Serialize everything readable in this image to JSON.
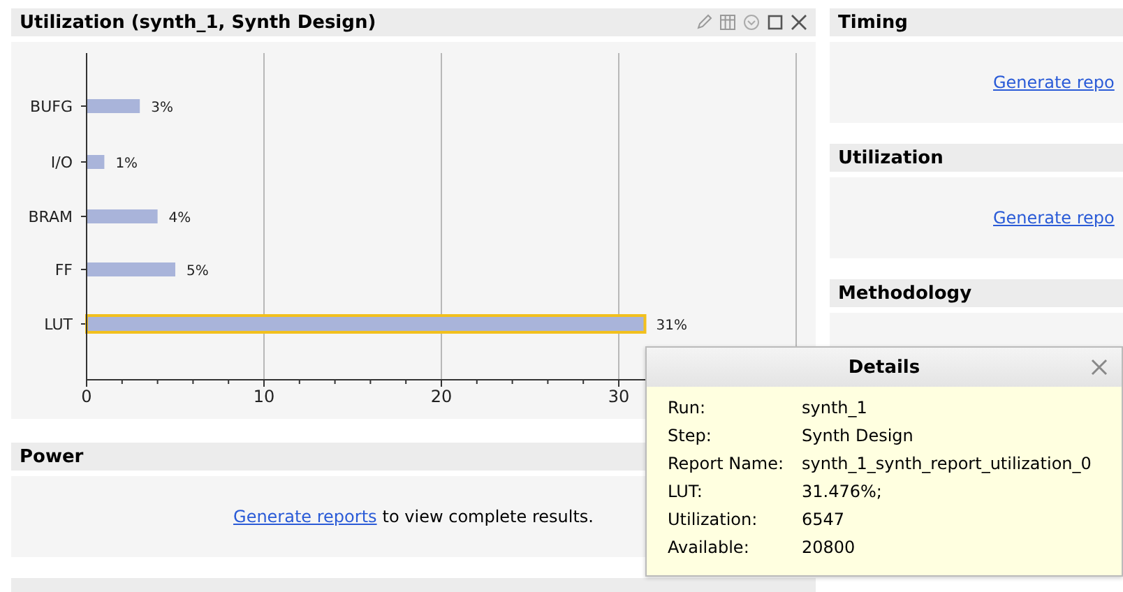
{
  "main_panel": {
    "title": "Utilization (synth_1, Synth Design)",
    "bars": [
      {
        "selected": false
      },
      {
        "selected": false
      },
      {
        "selected": false
      },
      {
        "selected": false
      },
      {
        "selected": true
      }
    ],
    "chart_data": {
      "type": "bar",
      "orientation": "horizontal",
      "categories": [
        "BUFG",
        "I/O",
        "BRAM",
        "FF",
        "LUT"
      ],
      "values": [
        3,
        1,
        4,
        5,
        31.476
      ],
      "value_labels": [
        "3%",
        "1%",
        "4%",
        "5%",
        "31%"
      ],
      "xlim": [
        0,
        40
      ],
      "xticks": [
        0,
        10,
        20,
        30
      ],
      "grid": true
    }
  },
  "left_panels": [
    {
      "title": "Power",
      "link": "Generate reports",
      "message": "to view complete results."
    }
  ],
  "right_panels": [
    {
      "title": "Timing",
      "link": "Generate repo"
    },
    {
      "title": "Utilization",
      "link": "Generate repo"
    },
    {
      "title": "Methodology"
    }
  ],
  "details": {
    "title": "Details",
    "rows": [
      {
        "label": "Run:",
        "value": "synth_1"
      },
      {
        "label": "Step:",
        "value": "Synth Design"
      },
      {
        "label": "Report Name:",
        "value": "synth_1_synth_report_utilization_0"
      },
      {
        "label": "LUT:",
        "value": "31.476%;"
      },
      {
        "label": "Utilization:",
        "value": "6547"
      },
      {
        "label": "Available:",
        "value": "20800"
      }
    ]
  }
}
